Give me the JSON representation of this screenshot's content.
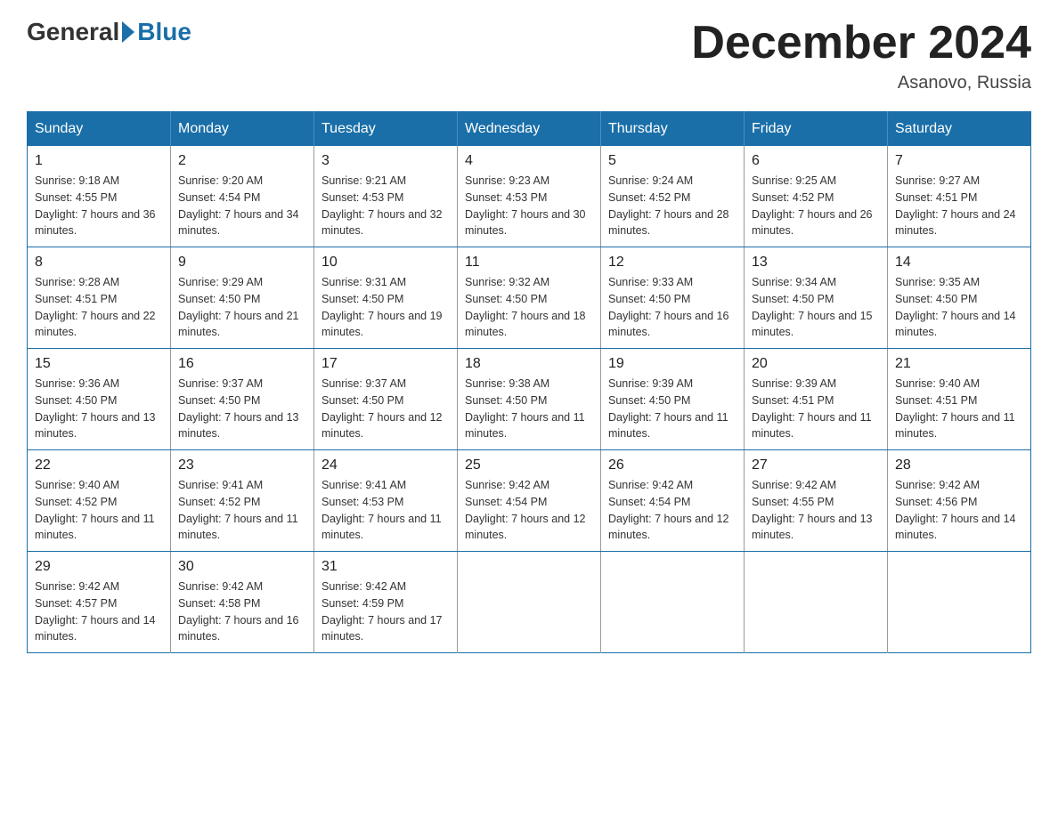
{
  "header": {
    "logo_general": "General",
    "logo_blue": "Blue",
    "month_title": "December 2024",
    "location": "Asanovo, Russia"
  },
  "days_of_week": [
    "Sunday",
    "Monday",
    "Tuesday",
    "Wednesday",
    "Thursday",
    "Friday",
    "Saturday"
  ],
  "weeks": [
    [
      {
        "day": "1",
        "sunrise": "Sunrise: 9:18 AM",
        "sunset": "Sunset: 4:55 PM",
        "daylight": "Daylight: 7 hours and 36 minutes."
      },
      {
        "day": "2",
        "sunrise": "Sunrise: 9:20 AM",
        "sunset": "Sunset: 4:54 PM",
        "daylight": "Daylight: 7 hours and 34 minutes."
      },
      {
        "day": "3",
        "sunrise": "Sunrise: 9:21 AM",
        "sunset": "Sunset: 4:53 PM",
        "daylight": "Daylight: 7 hours and 32 minutes."
      },
      {
        "day": "4",
        "sunrise": "Sunrise: 9:23 AM",
        "sunset": "Sunset: 4:53 PM",
        "daylight": "Daylight: 7 hours and 30 minutes."
      },
      {
        "day": "5",
        "sunrise": "Sunrise: 9:24 AM",
        "sunset": "Sunset: 4:52 PM",
        "daylight": "Daylight: 7 hours and 28 minutes."
      },
      {
        "day": "6",
        "sunrise": "Sunrise: 9:25 AM",
        "sunset": "Sunset: 4:52 PM",
        "daylight": "Daylight: 7 hours and 26 minutes."
      },
      {
        "day": "7",
        "sunrise": "Sunrise: 9:27 AM",
        "sunset": "Sunset: 4:51 PM",
        "daylight": "Daylight: 7 hours and 24 minutes."
      }
    ],
    [
      {
        "day": "8",
        "sunrise": "Sunrise: 9:28 AM",
        "sunset": "Sunset: 4:51 PM",
        "daylight": "Daylight: 7 hours and 22 minutes."
      },
      {
        "day": "9",
        "sunrise": "Sunrise: 9:29 AM",
        "sunset": "Sunset: 4:50 PM",
        "daylight": "Daylight: 7 hours and 21 minutes."
      },
      {
        "day": "10",
        "sunrise": "Sunrise: 9:31 AM",
        "sunset": "Sunset: 4:50 PM",
        "daylight": "Daylight: 7 hours and 19 minutes."
      },
      {
        "day": "11",
        "sunrise": "Sunrise: 9:32 AM",
        "sunset": "Sunset: 4:50 PM",
        "daylight": "Daylight: 7 hours and 18 minutes."
      },
      {
        "day": "12",
        "sunrise": "Sunrise: 9:33 AM",
        "sunset": "Sunset: 4:50 PM",
        "daylight": "Daylight: 7 hours and 16 minutes."
      },
      {
        "day": "13",
        "sunrise": "Sunrise: 9:34 AM",
        "sunset": "Sunset: 4:50 PM",
        "daylight": "Daylight: 7 hours and 15 minutes."
      },
      {
        "day": "14",
        "sunrise": "Sunrise: 9:35 AM",
        "sunset": "Sunset: 4:50 PM",
        "daylight": "Daylight: 7 hours and 14 minutes."
      }
    ],
    [
      {
        "day": "15",
        "sunrise": "Sunrise: 9:36 AM",
        "sunset": "Sunset: 4:50 PM",
        "daylight": "Daylight: 7 hours and 13 minutes."
      },
      {
        "day": "16",
        "sunrise": "Sunrise: 9:37 AM",
        "sunset": "Sunset: 4:50 PM",
        "daylight": "Daylight: 7 hours and 13 minutes."
      },
      {
        "day": "17",
        "sunrise": "Sunrise: 9:37 AM",
        "sunset": "Sunset: 4:50 PM",
        "daylight": "Daylight: 7 hours and 12 minutes."
      },
      {
        "day": "18",
        "sunrise": "Sunrise: 9:38 AM",
        "sunset": "Sunset: 4:50 PM",
        "daylight": "Daylight: 7 hours and 11 minutes."
      },
      {
        "day": "19",
        "sunrise": "Sunrise: 9:39 AM",
        "sunset": "Sunset: 4:50 PM",
        "daylight": "Daylight: 7 hours and 11 minutes."
      },
      {
        "day": "20",
        "sunrise": "Sunrise: 9:39 AM",
        "sunset": "Sunset: 4:51 PM",
        "daylight": "Daylight: 7 hours and 11 minutes."
      },
      {
        "day": "21",
        "sunrise": "Sunrise: 9:40 AM",
        "sunset": "Sunset: 4:51 PM",
        "daylight": "Daylight: 7 hours and 11 minutes."
      }
    ],
    [
      {
        "day": "22",
        "sunrise": "Sunrise: 9:40 AM",
        "sunset": "Sunset: 4:52 PM",
        "daylight": "Daylight: 7 hours and 11 minutes."
      },
      {
        "day": "23",
        "sunrise": "Sunrise: 9:41 AM",
        "sunset": "Sunset: 4:52 PM",
        "daylight": "Daylight: 7 hours and 11 minutes."
      },
      {
        "day": "24",
        "sunrise": "Sunrise: 9:41 AM",
        "sunset": "Sunset: 4:53 PM",
        "daylight": "Daylight: 7 hours and 11 minutes."
      },
      {
        "day": "25",
        "sunrise": "Sunrise: 9:42 AM",
        "sunset": "Sunset: 4:54 PM",
        "daylight": "Daylight: 7 hours and 12 minutes."
      },
      {
        "day": "26",
        "sunrise": "Sunrise: 9:42 AM",
        "sunset": "Sunset: 4:54 PM",
        "daylight": "Daylight: 7 hours and 12 minutes."
      },
      {
        "day": "27",
        "sunrise": "Sunrise: 9:42 AM",
        "sunset": "Sunset: 4:55 PM",
        "daylight": "Daylight: 7 hours and 13 minutes."
      },
      {
        "day": "28",
        "sunrise": "Sunrise: 9:42 AM",
        "sunset": "Sunset: 4:56 PM",
        "daylight": "Daylight: 7 hours and 14 minutes."
      }
    ],
    [
      {
        "day": "29",
        "sunrise": "Sunrise: 9:42 AM",
        "sunset": "Sunset: 4:57 PM",
        "daylight": "Daylight: 7 hours and 14 minutes."
      },
      {
        "day": "30",
        "sunrise": "Sunrise: 9:42 AM",
        "sunset": "Sunset: 4:58 PM",
        "daylight": "Daylight: 7 hours and 16 minutes."
      },
      {
        "day": "31",
        "sunrise": "Sunrise: 9:42 AM",
        "sunset": "Sunset: 4:59 PM",
        "daylight": "Daylight: 7 hours and 17 minutes."
      },
      null,
      null,
      null,
      null
    ]
  ]
}
